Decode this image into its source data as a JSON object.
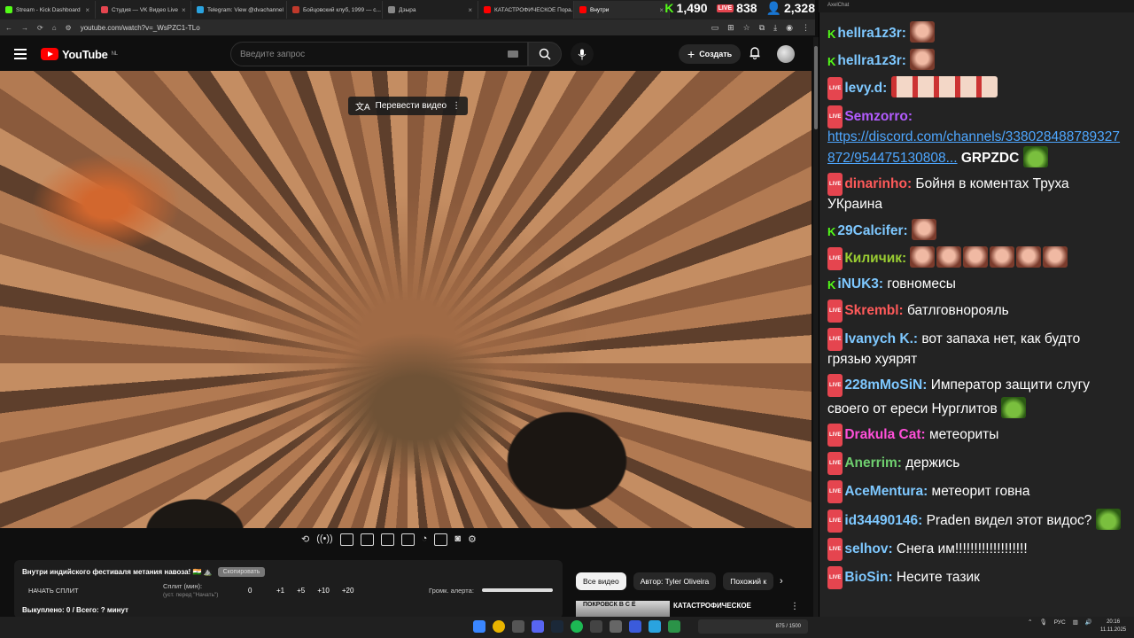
{
  "browser": {
    "tabs": [
      {
        "label": "Stream - Kick Dashboard",
        "color": "#53fc18"
      },
      {
        "label": "Студия — VK Видео Live",
        "color": "#e5454f"
      },
      {
        "label": "Telegram: View @dvachannel",
        "color": "#2aa3df"
      },
      {
        "label": "Бойцовский клуб, 1999 — с...",
        "color": "#c0392b"
      },
      {
        "label": "Дзырa",
        "color": "#888888"
      },
      {
        "label": "КАТАСТРОФИЧЕСКОЕ Пора...",
        "color": "#ff0000"
      },
      {
        "label": "Внутри",
        "color": "#ff0000"
      }
    ],
    "url": "youtube.com/watch?v=_WsPZC1-TLo",
    "counters": {
      "kick": "1,490",
      "vk": "838",
      "viewers": "2,328",
      "vk_badge": "LIVE",
      "kick_badge": "K"
    }
  },
  "youtube": {
    "logo": "YouTube",
    "region": "NL",
    "search_placeholder": "Введите запрос",
    "create_label": "Создать",
    "translate_label": "Перевести видео"
  },
  "panel": {
    "video_title": "Внутри индийского фестиваля метания навоза! 🇮🇳 ⛰️",
    "copy_label": "Скопировать",
    "split_button": "НАЧАТЬ СПЛИТ",
    "split_min_label": "Сплит (мин):",
    "split_hint": "(уст. перед \"Начать\")",
    "split_value": "0",
    "split_options": [
      "+1",
      "+5",
      "+10",
      "+20"
    ],
    "volume_label": "Громк. алерта:",
    "bought": "Выкуплено: 0 / Всего: ? минут"
  },
  "chips": [
    "Все видео",
    "Автор: Tyler Oliveira",
    "Похожий к"
  ],
  "recommendation": {
    "thumb_text": "ПОКРОВСК В С Ё",
    "title": "КАТАСТРОФИЧЕСКОЕ"
  },
  "chat": {
    "window_title": "AxelChat",
    "messages": [
      {
        "platform": "kick",
        "nick": "hellra1z3r",
        "color": "#7ec8ff",
        "text": "",
        "emotes": 1
      },
      {
        "platform": "kick",
        "nick": "hellra1z3r",
        "color": "#7ec8ff",
        "text": "",
        "emotes": 1
      },
      {
        "platform": "vk",
        "nick": "levy.d",
        "color": "#7ec8ff",
        "text": "",
        "emotes": "wide"
      },
      {
        "platform": "vk",
        "nick": "Semzorro",
        "color": "#b35cff",
        "link": "https://discord.com/channels/338028488789327872/954475130808...",
        "text": "GRPZDC"
      },
      {
        "platform": "vk",
        "nick": "dinarinho",
        "color": "#ff5a5a",
        "text": "Бойня в коментах Труха УКраина"
      },
      {
        "platform": "kick",
        "nick": "29Calcifer",
        "color": "#7ec8ff",
        "text": "",
        "emotes": 1
      },
      {
        "platform": "vk",
        "nick": "Киличик",
        "color": "#9acd32",
        "text": "",
        "emotes": 6
      },
      {
        "platform": "kick",
        "nick": "iNUK3",
        "color": "#7ec8ff",
        "text": "говномесы"
      },
      {
        "platform": "vk",
        "nick": "Skrembl",
        "color": "#ff5a5a",
        "text": "батлговнорояль"
      },
      {
        "platform": "vk",
        "nick": "Ivanych K.",
        "color": "#7ec8ff",
        "text": "вот запаха нет, как будто грязью хуярят"
      },
      {
        "platform": "vk",
        "nick": "228mMoSiN",
        "color": "#7ec8ff",
        "text": "Император защити слугу своего от ереси Нурглитов"
      },
      {
        "platform": "vk",
        "nick": "Drakula Cat",
        "color": "#ff4fd8",
        "text": "метеориты"
      },
      {
        "platform": "vk",
        "nick": "Anerrim",
        "color": "#6fcf6f",
        "text": "держись"
      },
      {
        "platform": "vk",
        "nick": "AceMentura",
        "color": "#7ec8ff",
        "text": "метеорит говна"
      },
      {
        "platform": "vk",
        "nick": "id34490146",
        "color": "#7ec8ff",
        "text": "Praden видел этот видос?"
      },
      {
        "platform": "vk",
        "nick": "selhov",
        "color": "#7ec8ff",
        "text": "Снега им!!!!!!!!!!!!!!!!!!!"
      },
      {
        "platform": "vk",
        "nick": "BioSin",
        "color": "#7ec8ff",
        "text": "Несите тазик"
      }
    ]
  },
  "taskbar": {
    "widget_text": "875 / 1500",
    "tray_lang": "РУС",
    "time": "20:16",
    "date": "11.11.2025"
  }
}
